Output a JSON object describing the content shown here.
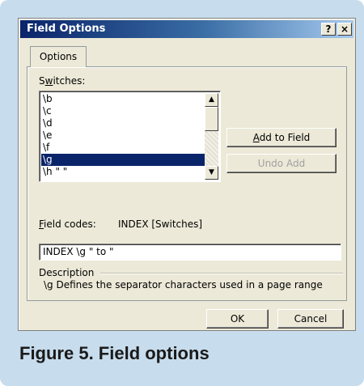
{
  "dialog": {
    "title": "Field Options",
    "help_button": "?",
    "close_button": "×"
  },
  "tab": {
    "label": "Options"
  },
  "switches": {
    "label_prefix": "S",
    "label_accel": "w",
    "label_suffix": "itches:",
    "items": [
      "\\b",
      "\\c",
      "\\d",
      "\\e",
      "\\f",
      "\\g",
      "\\h \" \""
    ],
    "selected_index": 5
  },
  "buttons": {
    "add_to_field_accel": "A",
    "add_to_field_rest": "dd to Field",
    "undo_add": "Undo Add",
    "ok": "OK",
    "cancel": "Cancel"
  },
  "field_codes": {
    "label_accel": "F",
    "label_rest": "ield codes:",
    "value": "INDEX [Switches]"
  },
  "field_input": {
    "value": "INDEX \\g \" to \""
  },
  "description": {
    "label": "Description",
    "text": "\\g Defines the separator characters used in a page range"
  },
  "figure": {
    "caption": "Figure 5. Field options"
  }
}
